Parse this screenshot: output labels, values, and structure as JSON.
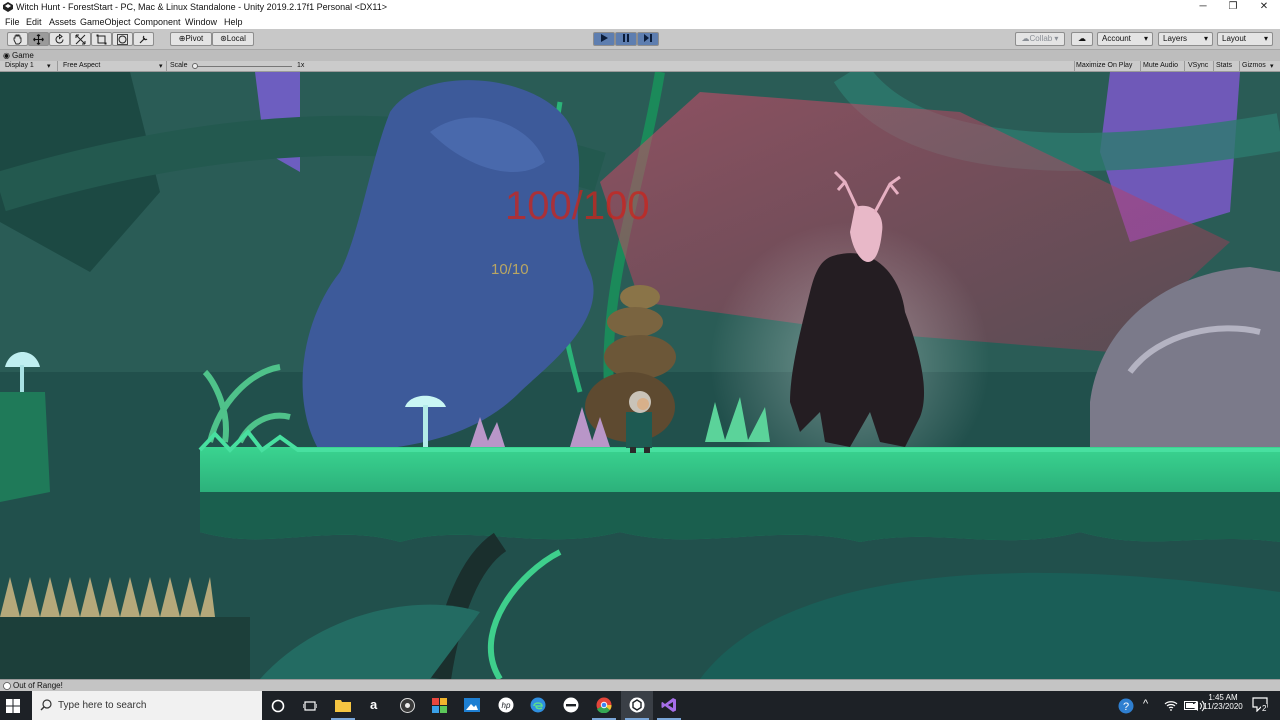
{
  "window": {
    "title": "Witch Hunt - ForestStart - PC, Mac & Linux Standalone - Unity 2019.2.17f1 Personal <DX11>",
    "controls": [
      "─",
      "❐",
      "✕"
    ]
  },
  "menu": [
    "File",
    "Edit",
    "Assets",
    "GameObject",
    "Component",
    "Window",
    "Help"
  ],
  "toolbar": {
    "tools": [
      "hand-tool",
      "move-tool",
      "rotate-tool",
      "scale-tool",
      "rect-tool",
      "transform-tool",
      "custom-tool"
    ],
    "pivot_label": "Pivot",
    "local_label": "Local",
    "collab_label": "Collab ▾",
    "account_label": "Account",
    "layers_label": "Layers",
    "layout_label": "Layout"
  },
  "game_tab": {
    "label": "Game",
    "display": "Display 1",
    "aspect": "Free Aspect",
    "scale_label": "Scale",
    "scale_value": "1x",
    "maximize_label": "Maximize On Play",
    "mute_label": "Mute Audio",
    "vsync_label": "VSync",
    "stats_label": "Stats",
    "gizmos_label": "Gizmos"
  },
  "hud": {
    "boss_health": "100/100",
    "player_health": "10/10"
  },
  "status": {
    "message": "Out of Range!"
  },
  "taskbar": {
    "search_placeholder": "Type here to search",
    "time": "1:45 AM",
    "date": "11/23/2020",
    "notification_count": "2",
    "apps": [
      "task-view",
      "file-explorer",
      "amazon",
      "media-player",
      "photos",
      "mail",
      "hp",
      "edge",
      "app-dark",
      "chrome",
      "unity",
      "visual-studio"
    ]
  },
  "colors": {
    "accent_play": "#5e7eb0",
    "hud_red": "#c8261f",
    "hud_gold": "#b9a663"
  }
}
